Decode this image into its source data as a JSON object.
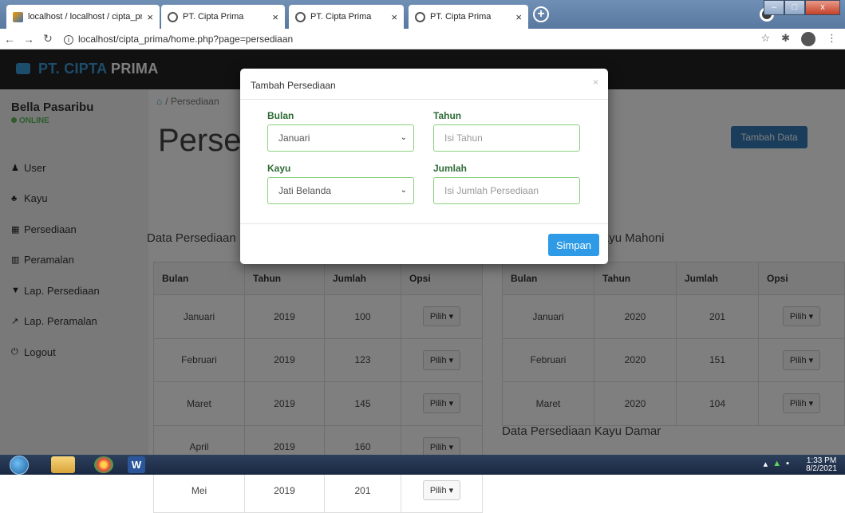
{
  "browser": {
    "tabs": [
      {
        "label": "localhost / localhost / cipta_prim",
        "icon": "phpmyadmin-icon"
      },
      {
        "label": "PT. Cipta Prima",
        "icon": "globe-icon"
      },
      {
        "label": "PT. Cipta Prima",
        "icon": "globe-icon"
      },
      {
        "label": "PT. Cipta Prima",
        "icon": "globe-icon"
      }
    ],
    "close_glyph": "×",
    "newtab_glyph": "+",
    "url": "localhost/cipta_prima/home.php?page=persediaan",
    "info_glyph": "i",
    "window_controls": {
      "minimize": "–",
      "maximize": "□",
      "close": "x"
    }
  },
  "app": {
    "brand_1": "PT. CIPTA",
    "brand_2": "PRIMA",
    "user": {
      "name": "Bella Pasaribu",
      "status": "ONLINE"
    },
    "menu": [
      {
        "label": "User",
        "icon": "user-icon",
        "glyph": "♟"
      },
      {
        "label": "Kayu",
        "icon": "tree-icon",
        "glyph": "♣"
      },
      {
        "label": "Persediaan",
        "icon": "calendar-icon",
        "glyph": "▦"
      },
      {
        "label": "Peramalan",
        "icon": "bar-chart-icon",
        "glyph": "▥"
      },
      {
        "label": "Lap. Persediaan",
        "icon": "cart-icon",
        "glyph": "▼"
      },
      {
        "label": "Lap. Peramalan",
        "icon": "line-chart-icon",
        "glyph": "↗"
      },
      {
        "label": "Logout",
        "icon": "power-icon",
        "glyph": "⏻"
      }
    ],
    "breadcrumb": {
      "home_glyph": "⌂",
      "separator": "/",
      "current": "Persediaan"
    },
    "page_title": "Persediaan",
    "add_button": "Tambah Data",
    "section_left_title": "Data Persediaan Kayu Jati Belanda",
    "section_right_title": "Data Persediaan Kayu Mahoni",
    "section_bottom_title": "Data Persediaan Kayu Damar",
    "columns": [
      "Bulan",
      "Tahun",
      "Jumlah",
      "Opsi"
    ],
    "pilih_label": "Pilih ▾",
    "left_rows": [
      [
        "Januari",
        "2019",
        "100"
      ],
      [
        "Februari",
        "2019",
        "123"
      ],
      [
        "Maret",
        "2019",
        "145"
      ],
      [
        "April",
        "2019",
        "160"
      ],
      [
        "Mei",
        "2019",
        "201"
      ]
    ],
    "right_rows": [
      [
        "Januari",
        "2020",
        "201"
      ],
      [
        "Februari",
        "2020",
        "151"
      ],
      [
        "Maret",
        "2020",
        "104"
      ]
    ]
  },
  "modal": {
    "title": "Tambah Persediaan",
    "close_glyph": "×",
    "bulan_label": "Bulan",
    "bulan_value": "Januari",
    "tahun_label": "Tahun",
    "tahun_placeholder": "Isi Tahun",
    "kayu_label": "Kayu",
    "kayu_value": "Jati Belanda",
    "jumlah_label": "Jumlah",
    "jumlah_placeholder": "Isi Jumlah Persediaan",
    "save_button": "Simpan",
    "caret": "⌄"
  },
  "taskbar": {
    "time": "1:33 PM",
    "date": "8/2/2021",
    "word_glyph": "W"
  }
}
